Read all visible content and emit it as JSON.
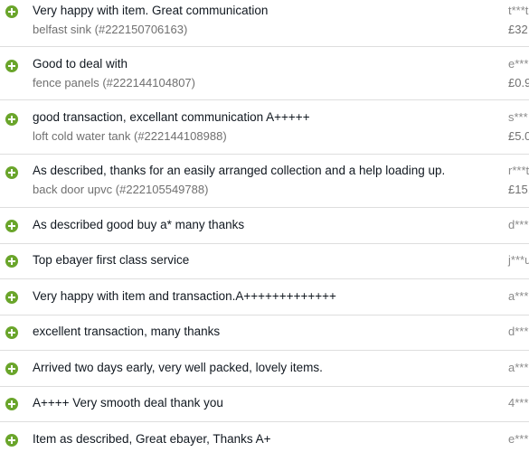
{
  "feedback": [
    {
      "comment": "Very happy with item. Great communication",
      "item": "belfast sink (#222150706163)",
      "user": "t***t",
      "price": "£32"
    },
    {
      "comment": "Good to deal with",
      "item": "fence panels (#222144104807)",
      "user": "e***",
      "price": "£0.9"
    },
    {
      "comment": "good transaction, excellant communication A+++++",
      "item": "loft cold water tank (#222144108988)",
      "user": "s***",
      "price": "£5.0"
    },
    {
      "comment": "As described, thanks for an easily arranged collection and a help loading up.",
      "item": "back door upvc (#222105549788)",
      "user": "r***t",
      "price": "£15."
    },
    {
      "comment": "As described good buy a* many thanks",
      "user": "d***"
    },
    {
      "comment": "Top ebayer first class service",
      "user": "j***u"
    },
    {
      "comment": "Very happy with item and transaction.A+++++++++++++",
      "user": "a***"
    },
    {
      "comment": "excellent transaction, many thanks",
      "user": "d***"
    },
    {
      "comment": "Arrived two days early, very well packed, lovely items.",
      "user": "a***"
    },
    {
      "comment": "A++++ Very smooth deal thank you",
      "user": "4***"
    },
    {
      "comment": "Item as described, Great ebayer, Thanks A+",
      "user": "e***"
    }
  ],
  "colors": {
    "positive_icon": "#6aa52b",
    "divider": "#dedede"
  },
  "icons": {
    "positive": "plus-circle-icon"
  }
}
